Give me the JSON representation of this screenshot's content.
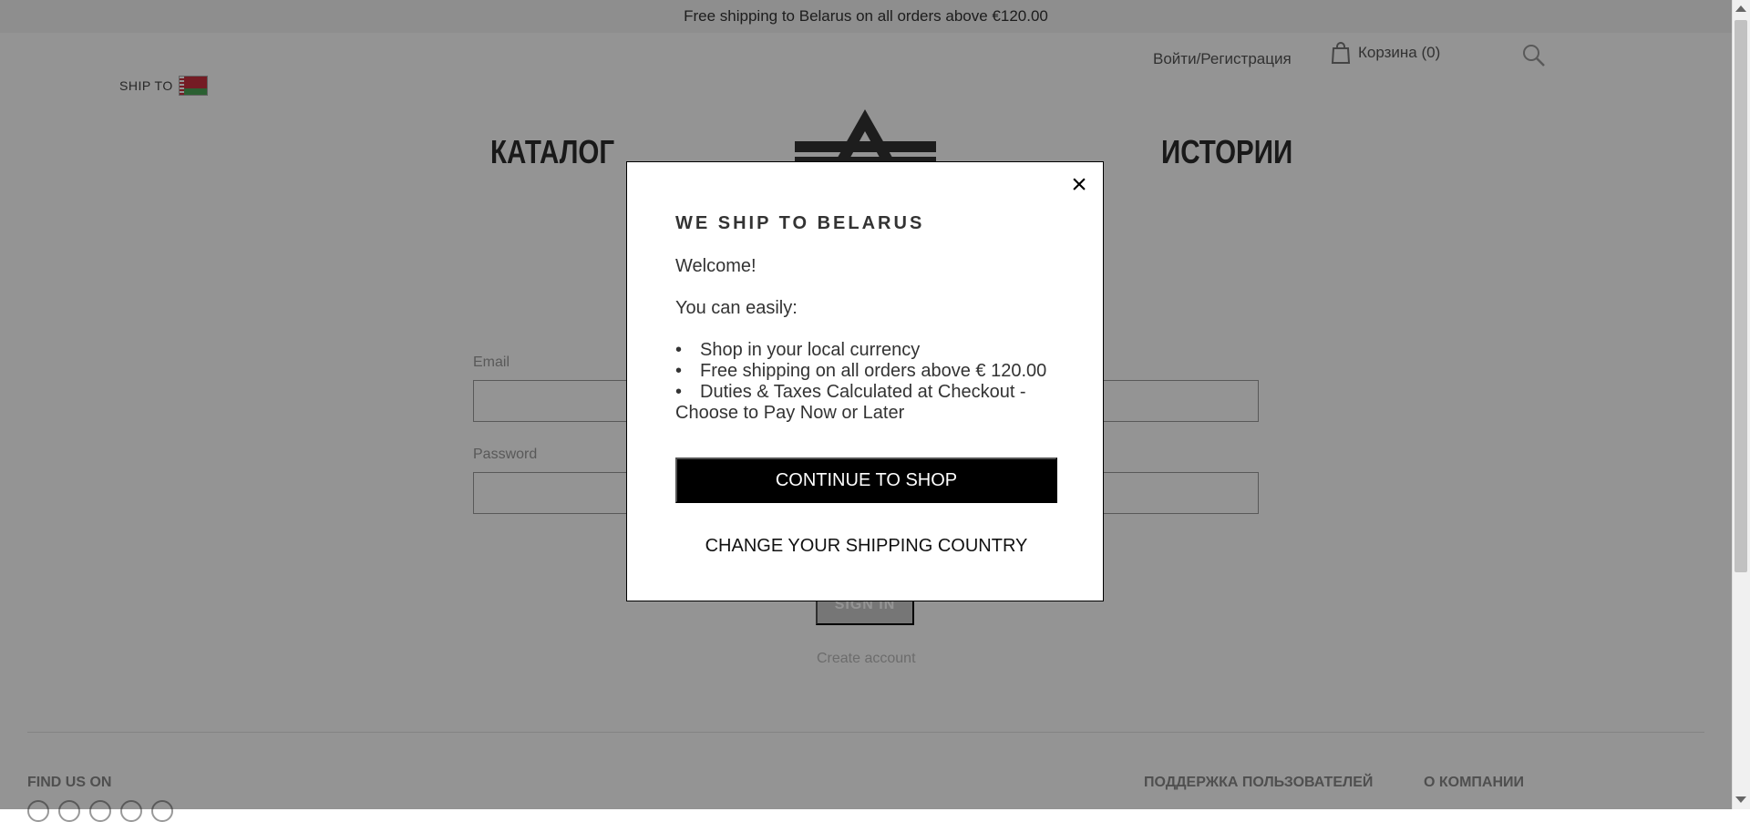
{
  "promo": {
    "text": "Free shipping to Belarus on all orders above €120.00"
  },
  "header": {
    "ship_to": "SHIP TO",
    "login": "Войти/Регистрация",
    "cart": "Корзина (0)",
    "search_icon": "search-icon",
    "cart_icon": "shopping-bag-icon"
  },
  "nav": {
    "left": "КАТАЛОГ",
    "right": "ИСТОРИИ"
  },
  "login_form": {
    "email_label": "Email",
    "password_label": "Password",
    "sign_in": "SIGN IN",
    "create_account": "Create account"
  },
  "footer": {
    "find_us": "FIND US ON",
    "support": "ПОДДЕРЖКА ПОЛЬЗОВАТЕЛЕЙ",
    "about": "О КОМПАНИИ"
  },
  "modal": {
    "title": "WE SHIP TO BELARUS",
    "welcome": "Welcome!",
    "easily": "You can easily:",
    "benefits": [
      "Shop in your local currency",
      "Free shipping on all orders above € 120.00",
      "Duties & Taxes Calculated at Checkout - Choose to Pay Now or Later"
    ],
    "continue_button": "CONTINUE TO SHOP",
    "change_country": "CHANGE YOUR SHIPPING COUNTRY",
    "close_icon": "close-icon"
  }
}
